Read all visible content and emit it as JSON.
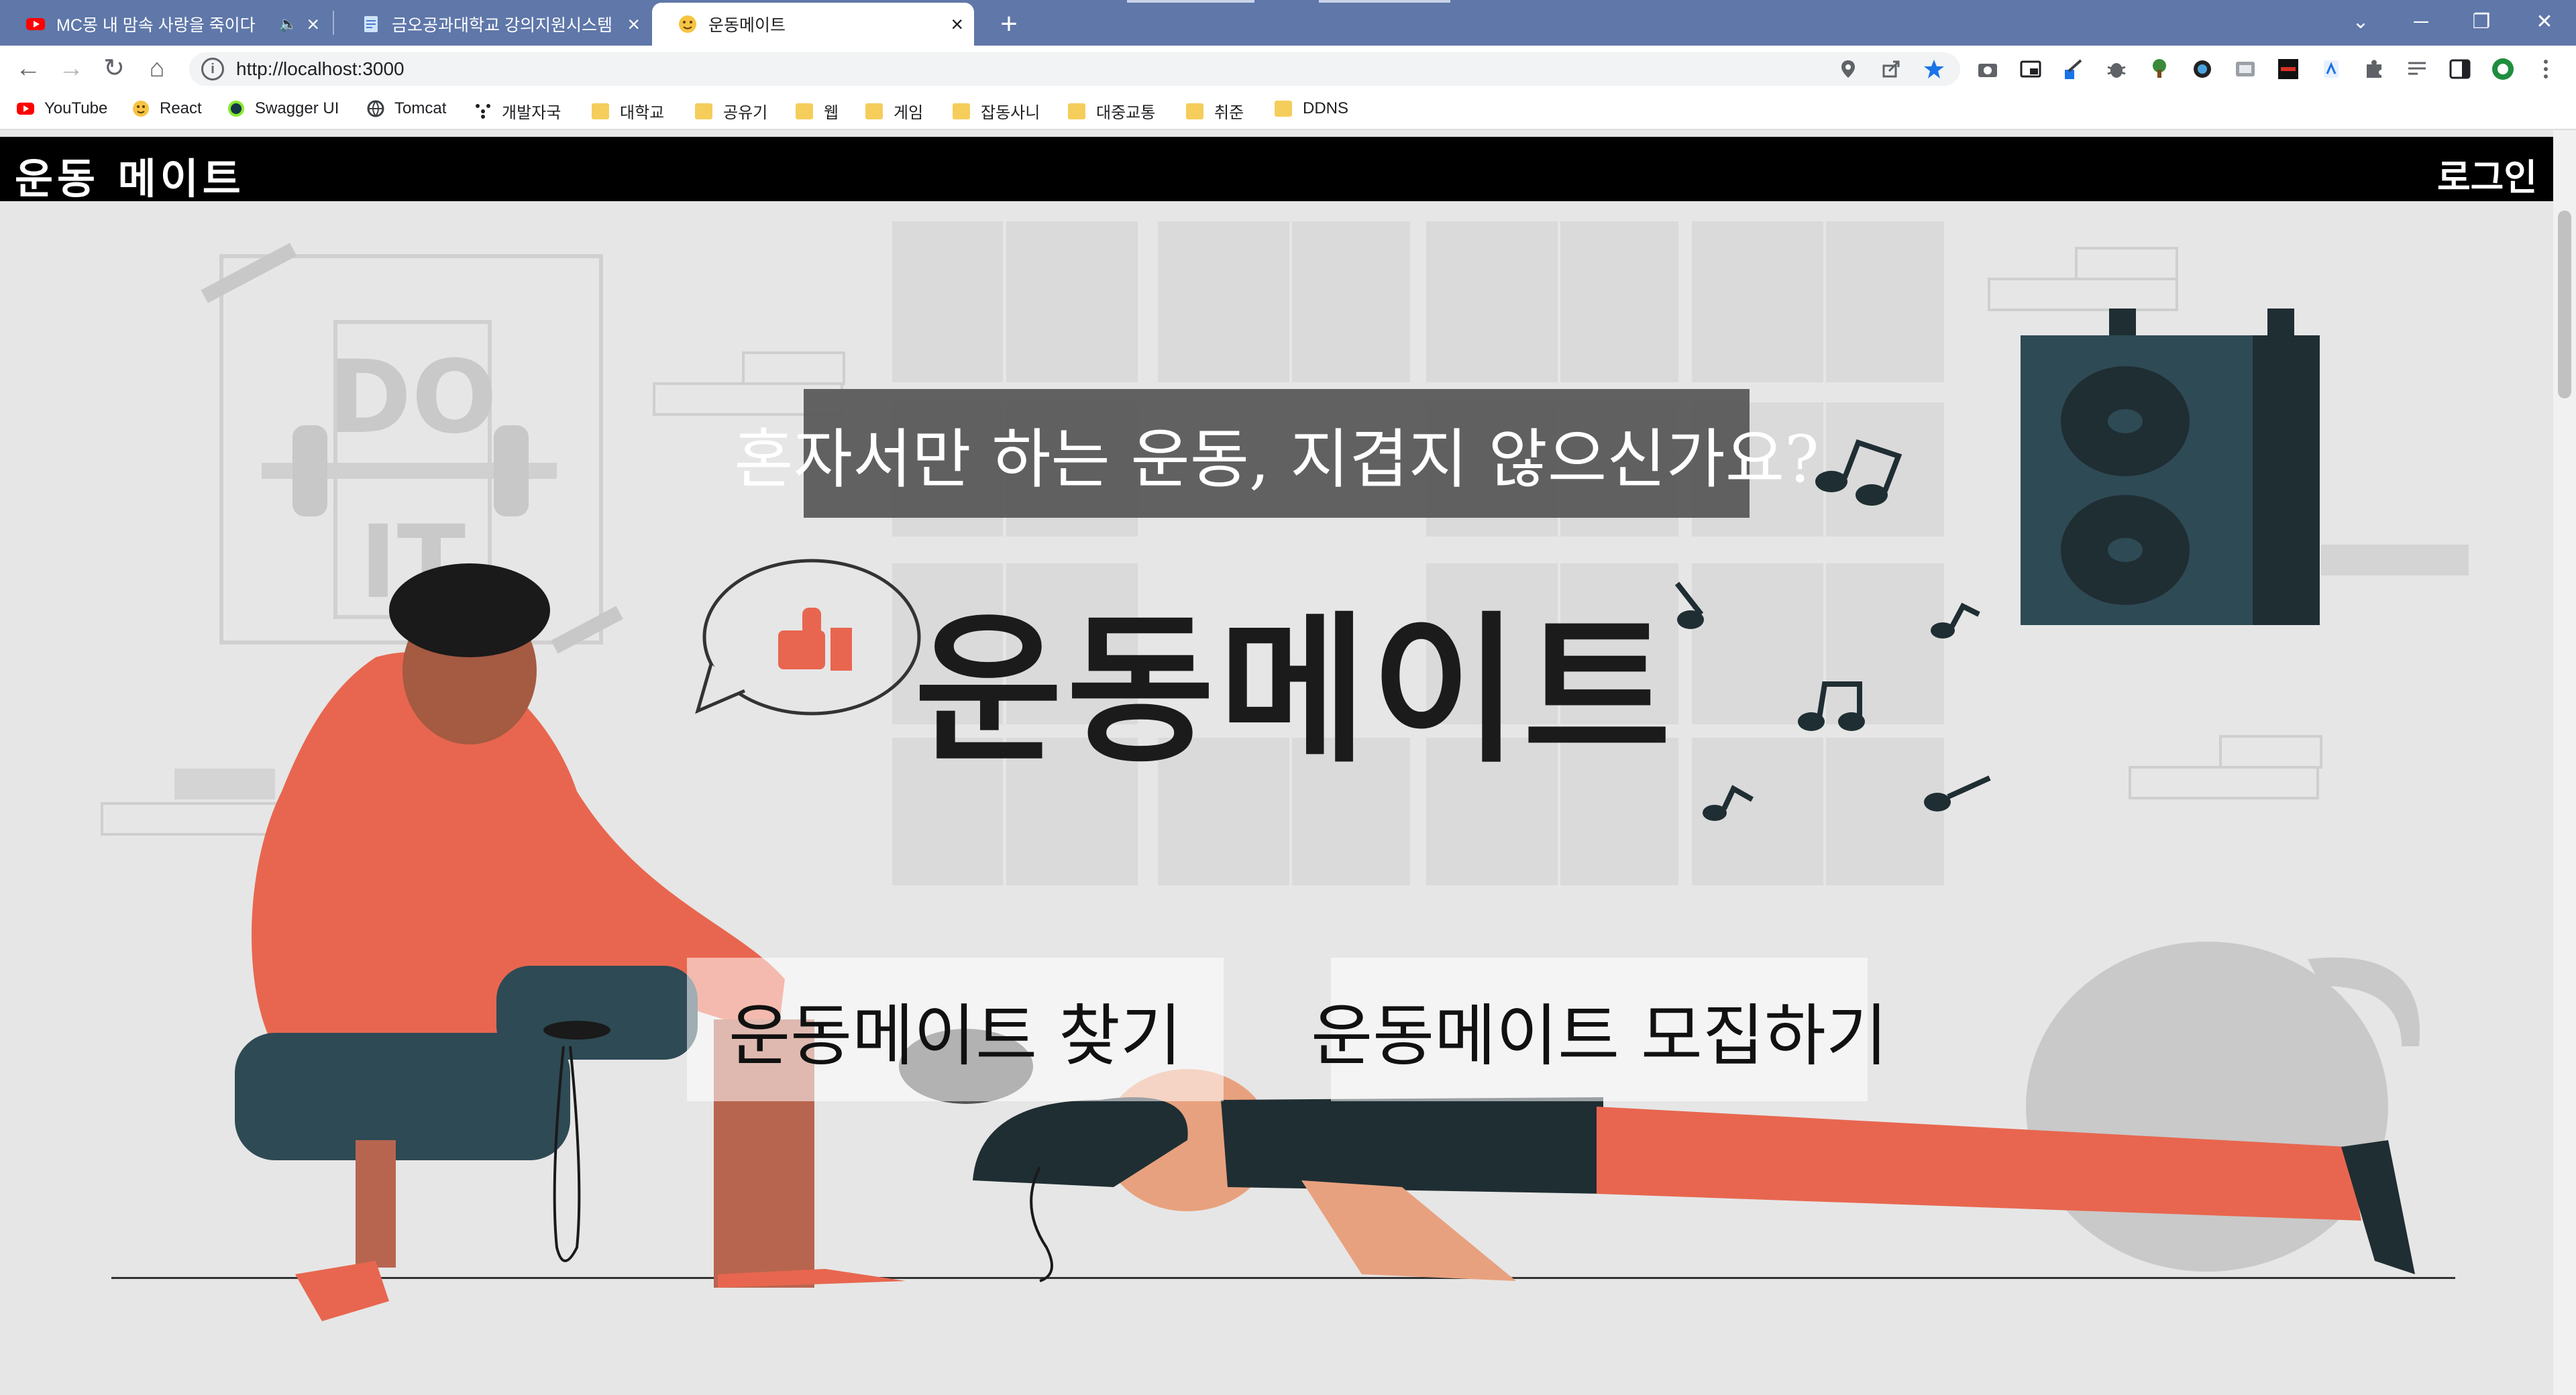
{
  "browser": {
    "tabs": [
      {
        "title": "MC몽 내 맘속 사랑을 죽이다",
        "icon": "youtube-icon",
        "audio": "🔈"
      },
      {
        "title": "금오공과대학교 강의지원시스템",
        "icon": "document-icon"
      },
      {
        "title": "운동메이트",
        "icon": "emoji-favicon",
        "active": true
      }
    ],
    "tab_close_glyph": "×",
    "new_tab_glyph": "+",
    "address": {
      "url": "http://localhost:3000"
    },
    "bookmarks": [
      {
        "label": "YouTube",
        "icon": "youtube-icon"
      },
      {
        "label": "React",
        "icon": "emoji-favicon"
      },
      {
        "label": "Swagger UI",
        "icon": "swagger-icon"
      },
      {
        "label": "Tomcat",
        "icon": "globe-icon"
      },
      {
        "label": "개발자국",
        "icon": "dots-icon"
      },
      {
        "label": "대학교",
        "icon": "folder-icon"
      },
      {
        "label": "공유기",
        "icon": "folder-icon"
      },
      {
        "label": "웹",
        "icon": "folder-icon"
      },
      {
        "label": "게임",
        "icon": "folder-icon"
      },
      {
        "label": "잡동사니",
        "icon": "folder-icon"
      },
      {
        "label": "대중교통",
        "icon": "folder-icon"
      },
      {
        "label": "취준",
        "icon": "folder-icon"
      },
      {
        "label": "DDNS",
        "icon": "folder-icon"
      }
    ]
  },
  "app": {
    "brand": "운동 메이트",
    "login": "로그인",
    "tagline": "혼자서만 하는 운동, 지겹지 않으신가요?",
    "hero_title": "운동메이트",
    "cta_find": "운동메이트 찾기",
    "cta_recruit": "운동메이트 모집하기",
    "poster_text": [
      "DO",
      "IT"
    ]
  },
  "colors": {
    "header": "#000000",
    "page_bg": "#e6e6e6",
    "tab_strip": "#5f77a9",
    "accent_orange": "#e8664f",
    "speaker": "#2e4a55"
  }
}
